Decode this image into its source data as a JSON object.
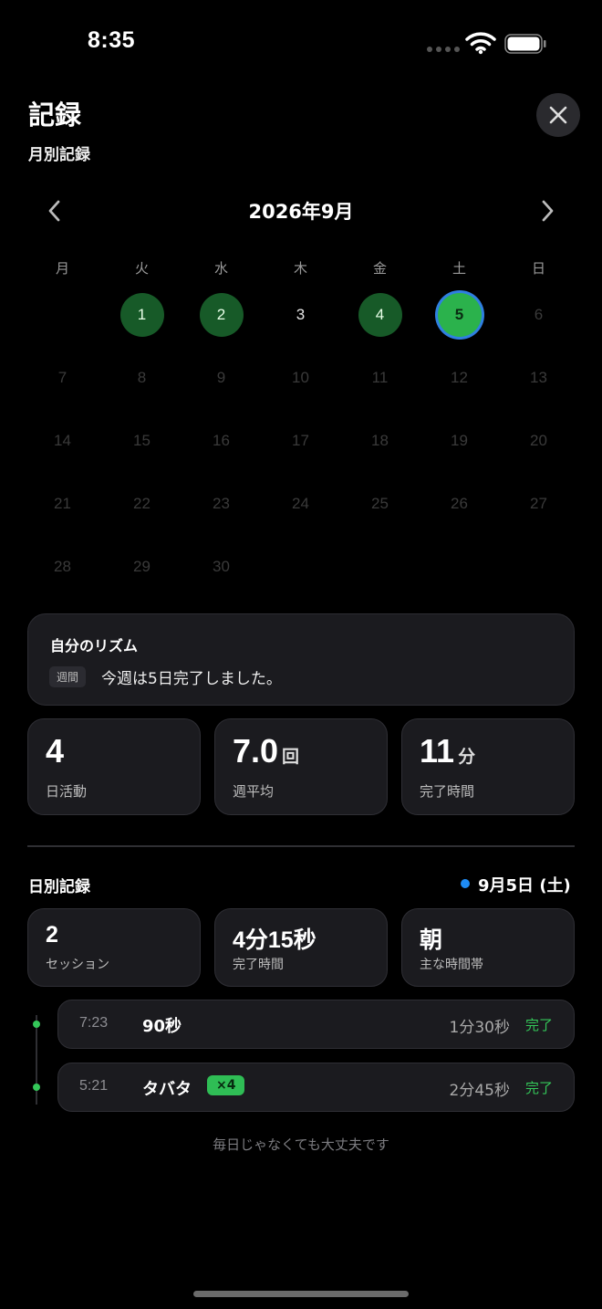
{
  "status_bar": {
    "time": "8:35"
  },
  "header": {
    "title": "記録",
    "subtitle": "月別記録"
  },
  "calendar": {
    "month_label": "2026年9月",
    "weekdays": [
      "月",
      "火",
      "水",
      "木",
      "金",
      "土",
      "日"
    ],
    "days": [
      {
        "n": "",
        "state": "empty"
      },
      {
        "n": "1",
        "state": "done"
      },
      {
        "n": "2",
        "state": "done"
      },
      {
        "n": "3",
        "state": "plain"
      },
      {
        "n": "4",
        "state": "done"
      },
      {
        "n": "5",
        "state": "today"
      },
      {
        "n": "6",
        "state": "future"
      },
      {
        "n": "7",
        "state": "future"
      },
      {
        "n": "8",
        "state": "future"
      },
      {
        "n": "9",
        "state": "future"
      },
      {
        "n": "10",
        "state": "future"
      },
      {
        "n": "11",
        "state": "future"
      },
      {
        "n": "12",
        "state": "future"
      },
      {
        "n": "13",
        "state": "future"
      },
      {
        "n": "14",
        "state": "future"
      },
      {
        "n": "15",
        "state": "future"
      },
      {
        "n": "16",
        "state": "future"
      },
      {
        "n": "17",
        "state": "future"
      },
      {
        "n": "18",
        "state": "future"
      },
      {
        "n": "19",
        "state": "future"
      },
      {
        "n": "20",
        "state": "future"
      },
      {
        "n": "21",
        "state": "future"
      },
      {
        "n": "22",
        "state": "future"
      },
      {
        "n": "23",
        "state": "future"
      },
      {
        "n": "24",
        "state": "future"
      },
      {
        "n": "25",
        "state": "future"
      },
      {
        "n": "26",
        "state": "future"
      },
      {
        "n": "27",
        "state": "future"
      },
      {
        "n": "28",
        "state": "future"
      },
      {
        "n": "29",
        "state": "future"
      },
      {
        "n": "30",
        "state": "future"
      }
    ]
  },
  "rhythm": {
    "title": "自分のリズム",
    "badge": "週間",
    "text": "今週は5日完了しました。"
  },
  "monthly_stats": [
    {
      "value": "4",
      "unit": "",
      "label": "日活動"
    },
    {
      "value": "7.0",
      "unit": "回",
      "label": "週平均"
    },
    {
      "value": "11",
      "unit": "分",
      "label": "完了時間"
    }
  ],
  "daily": {
    "title": "日別記録",
    "date_label": "9月5日 (土)",
    "stats": [
      {
        "value": "2",
        "label": "セッション"
      },
      {
        "value": "4分15秒",
        "label": "完了時間"
      },
      {
        "value": "朝",
        "label": "主な時間帯"
      }
    ],
    "sessions": [
      {
        "time": "7:23",
        "name": "90秒",
        "multiplier": "",
        "duration": "1分30秒",
        "status": "完了"
      },
      {
        "time": "5:21",
        "name": "タバタ",
        "multiplier": "×4",
        "duration": "2分45秒",
        "status": "完了"
      }
    ]
  },
  "footer_note": "毎日じゃなくても大丈夫です",
  "colors": {
    "done": "#175a28",
    "today": "#2bb24c",
    "accent_blue": "#1e8cf5",
    "status_green": "#34c759"
  }
}
